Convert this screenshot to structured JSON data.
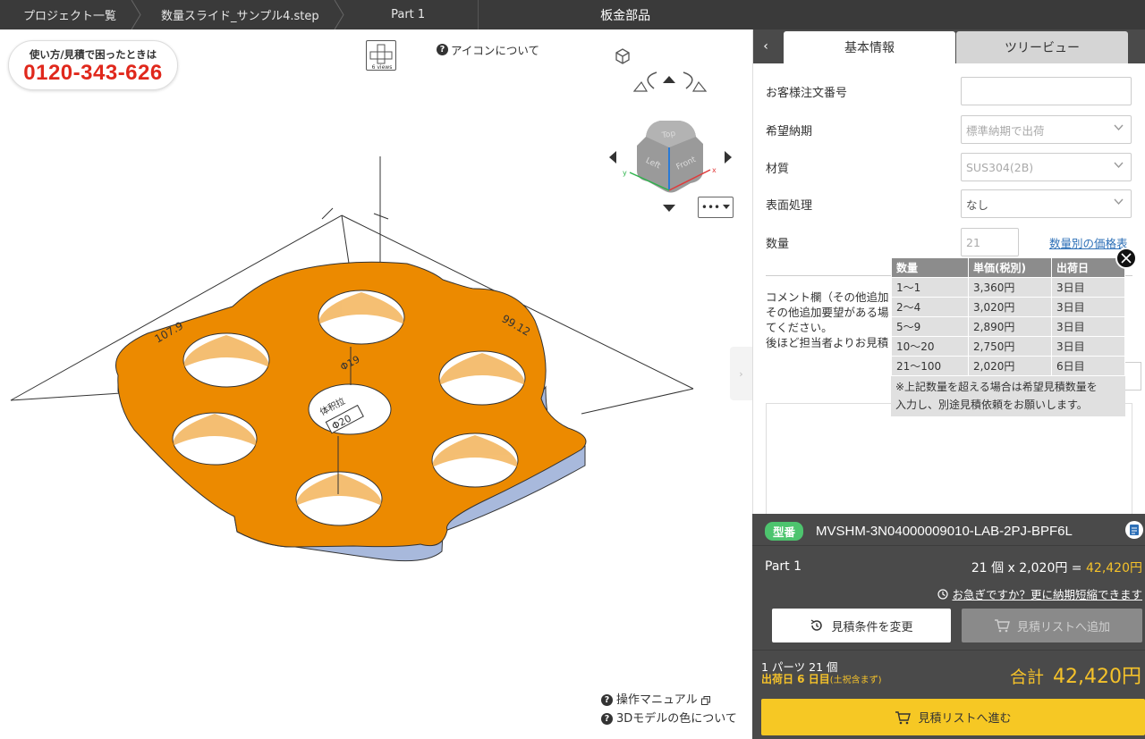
{
  "breadcrumb": {
    "items": [
      "プロジェクト一覧",
      "数量スライド_サンプル4.step",
      "Part 1"
    ],
    "title": "板金部品"
  },
  "viewer": {
    "phone_label": "使い方/見積で困ったときは",
    "phone_number": "0120-343-626",
    "views_label": "6 views",
    "icon_help": "アイコンについて",
    "more_label": "•••",
    "dimensions": {
      "length": "107.9",
      "width": "99.12",
      "hole_small": "Φ19",
      "hole_center": "Φ20",
      "center_label": "体积拉"
    },
    "footer": {
      "manual": "操作マニュアル",
      "model_color": "3Dモデルの色について"
    },
    "cube_faces": {
      "top": "Top",
      "left": "Left",
      "front": "Front"
    }
  },
  "panel": {
    "tabs": [
      "基本情報",
      "ツリービュー"
    ],
    "form": {
      "order_no": {
        "label": "お客様注文番号",
        "value": ""
      },
      "delivery": {
        "label": "希望納期",
        "value": "標準納期で出荷"
      },
      "material": {
        "label": "材質",
        "value": "SUS304(2B)"
      },
      "surface": {
        "label": "表面処理",
        "value": "なし"
      },
      "quantity": {
        "label": "数量",
        "value": "21"
      },
      "price_link": "数量別の価格表",
      "comment_lines": [
        "コメント欄（その他追加",
        "その他追加要望がある場",
        "てください。",
        "後ほど担当者よりお見積"
      ]
    },
    "price_table": {
      "headers": [
        "数量",
        "単価(税別)",
        "出荷日"
      ],
      "rows": [
        [
          "1〜1",
          "3,360円",
          "3日目"
        ],
        [
          "2〜4",
          "3,020円",
          "3日目"
        ],
        [
          "5〜9",
          "2,890円",
          "3日目"
        ],
        [
          "10〜20",
          "2,750円",
          "3日目"
        ],
        [
          "21〜100",
          "2,020円",
          "6日目"
        ]
      ],
      "note_lines": [
        "※上記数量を超える場合は希望見積数量を",
        "入力し、別途見積依頼をお願いします。"
      ]
    },
    "summary": {
      "badge": "型番",
      "model_no": "MVSHM-3N04000009010-LAB-2PJ-BPF6L",
      "part_name": "Part 1",
      "calc_prefix": "21 個  x 2,020円 = ",
      "calc_total": "42,420円",
      "rush_link": "お急ぎですか？更に納期短縮できます",
      "btn_change": "見積条件を変更",
      "btn_add": "見積リストへ追加",
      "parts_count": "1 パーツ 21 個",
      "ship_day": "出荷日 6 日目",
      "ship_day_note": "(土祝含まず)",
      "total_label": "合計",
      "total_value": "42,420円",
      "btn_proceed": "見積リストへ進む"
    }
  },
  "colors": {
    "accent_yellow": "#f6c824",
    "model_orange": "#ec8a00",
    "phone_red": "#e0281c",
    "badge_green": "#4dc46e",
    "link_blue": "#2c6fb7"
  }
}
